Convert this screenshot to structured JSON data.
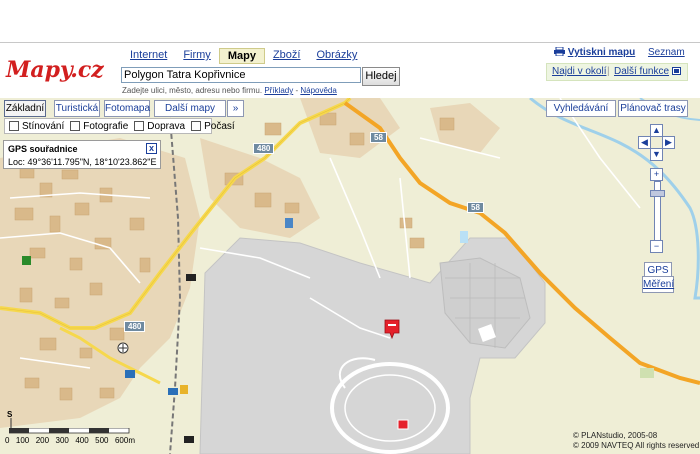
{
  "logo_text": "Mapy.cz",
  "search_tabs": [
    {
      "label": "Internet",
      "active": false
    },
    {
      "label": "Firmy",
      "active": false
    },
    {
      "label": "Mapy",
      "active": true
    },
    {
      "label": "Zboží",
      "active": false
    },
    {
      "label": "Obrázky",
      "active": false
    }
  ],
  "search": {
    "value": "Polygon Tatra Kopřivnice",
    "button_label": "Hledej",
    "hint_text": "Zadejte ulici, město, adresu nebo firmu.",
    "hint_examples": "Příklady",
    "hint_separator": "-",
    "hint_help": "Nápověda"
  },
  "header_links": {
    "print": "Vytiskni mapu",
    "seznam": "Seznam",
    "find_nearby": "Najdi v okolí",
    "more_functions": "Další funkce"
  },
  "map_types": [
    {
      "label": "Základní",
      "active": true
    },
    {
      "label": "Turistická",
      "active": false
    },
    {
      "label": "Fotomapa",
      "active": false
    },
    {
      "label": "Další mapy",
      "active": false
    }
  ],
  "expand_glyph": "»",
  "layers": [
    {
      "label": "Stínování",
      "checked": false
    },
    {
      "label": "Fotografie",
      "checked": false
    },
    {
      "label": "Doprava",
      "checked": false
    },
    {
      "label": "Počasí",
      "checked": false
    }
  ],
  "right_buttons": {
    "search": "Vyhledávání",
    "route": "Plánovač trasy",
    "gps": "GPS",
    "measure": "Měření"
  },
  "gps_box": {
    "title": "GPS souřadnice",
    "close": "x",
    "value": "Loc: 49°36'11.795\"N, 18°10'23.862\"E"
  },
  "road_labels": [
    "480",
    "58",
    "58",
    "480"
  ],
  "scale": {
    "ticks": [
      "0",
      "100",
      "200",
      "300",
      "400",
      "500",
      "600"
    ],
    "unit": "m",
    "north": "S"
  },
  "copyright": [
    "© PLANstudio, 2005-08",
    "© 2009 NAVTEQ All rights reserved"
  ],
  "colors": {
    "land": "#efeed6",
    "polygon": "#d6d6d6",
    "road_major": "#f6d84d",
    "road_route": "#f3a526",
    "river": "#9fd0ea",
    "marker": "#e5212b"
  }
}
